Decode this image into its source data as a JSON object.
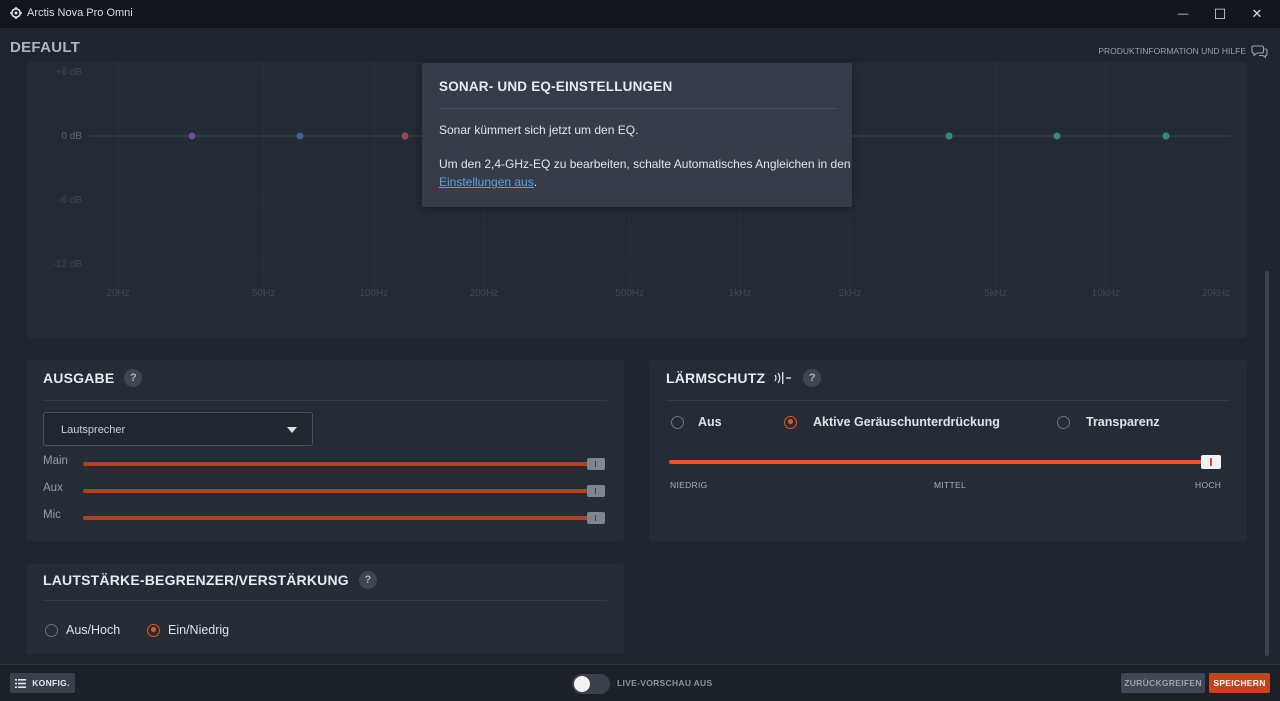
{
  "window": {
    "title": "Arctis Nova Pro Omni",
    "minimize_glyph": "—",
    "maximize_glyph": "☐",
    "close_glyph": "✕"
  },
  "header": {
    "preset": "DEFAULT",
    "help_link": "PRODUKTINFORMATION UND HILFE"
  },
  "eq": {
    "db_labels": [
      "+6 dB",
      "0 dB",
      "-6 dB",
      "-12 dB"
    ],
    "freq_labels": [
      "20Hz",
      "50Hz",
      "100Hz",
      "200Hz",
      "500Hz",
      "1kHz",
      "2kHz",
      "5kHz",
      "10kHz",
      "20kHz"
    ],
    "bands_visible": 6,
    "band_gain_db": [
      0,
      0,
      0,
      0,
      0,
      0
    ],
    "band_colors": [
      "#6b4f8f",
      "#4a5a9a",
      "#8f4a5e",
      "#2f8f7a",
      "#2f8f7a",
      "#2f8f7a"
    ]
  },
  "tooltip": {
    "title": "SONAR- UND EQ-EINSTELLUNGEN",
    "line1": "Sonar kümmert sich jetzt um den EQ.",
    "line2_before": "Um den 2,4-GHz-EQ zu bearbeiten, schalte Automatisches Angleichen in den ",
    "line2_link": "Einstellungen aus",
    "line2_after": "."
  },
  "output": {
    "title": "AUSGABE",
    "help": "?",
    "device": "Lautsprecher",
    "sliders": [
      {
        "label": "Main",
        "value": 1.0
      },
      {
        "label": "Aux",
        "value": 1.0
      },
      {
        "label": "Mic",
        "value": 1.0
      }
    ]
  },
  "noise": {
    "title": "LÄRMSCHUTZ",
    "help": "?",
    "options": [
      "Aus",
      "Aktive Geräuschunterdrückung",
      "Transparenz"
    ],
    "selected": "Aktive Geräuschunterdrückung",
    "level_labels": [
      "NIEDRIG",
      "MITTEL",
      "HOCH"
    ],
    "level": 1.0
  },
  "limiter": {
    "title": "LAUTSTÄRKE-BEGRENZER/VERSTÄRKUNG",
    "help": "?",
    "options": [
      "Aus/Hoch",
      "Ein/Niedrig"
    ],
    "selected": "Ein/Niedrig"
  },
  "footer": {
    "config_label": "KONFIG.",
    "live_preview": "LIVE-VORSCHAU AUS",
    "live_preview_on": false,
    "revert_label": "ZURÜCKGREIFEN",
    "save_label": "SPEICHERN"
  },
  "colors": {
    "accent": "#e65a22",
    "save_bg": "#c4441b",
    "link": "#4fa6e8"
  }
}
